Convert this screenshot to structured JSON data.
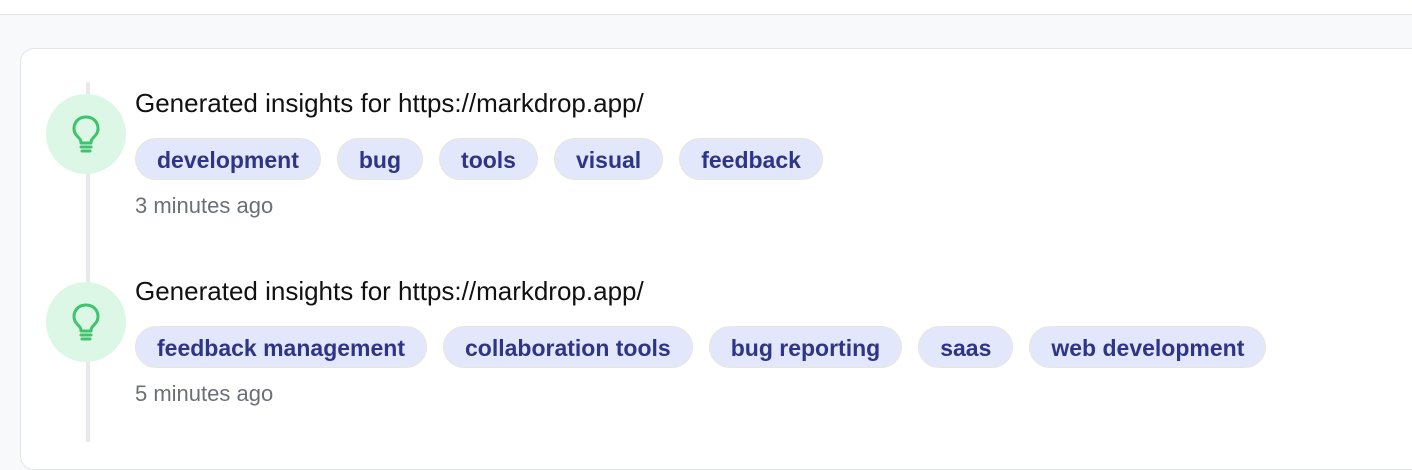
{
  "activity": [
    {
      "icon": "lightbulb-icon",
      "title": "Generated insights for https://markdrop.app/",
      "tags": [
        "development",
        "bug",
        "tools",
        "visual",
        "feedback"
      ],
      "time": "3 minutes ago"
    },
    {
      "icon": "lightbulb-icon",
      "title": "Generated insights for https://markdrop.app/",
      "tags": [
        "feedback management",
        "collaboration tools",
        "bug reporting",
        "saas",
        "web development"
      ],
      "time": "5 minutes ago"
    }
  ],
  "colors": {
    "icon_bg": "#dcf7e6",
    "icon_stroke": "#3ec46d",
    "tag_bg": "#e2e7fb",
    "tag_text": "#2e3587"
  }
}
